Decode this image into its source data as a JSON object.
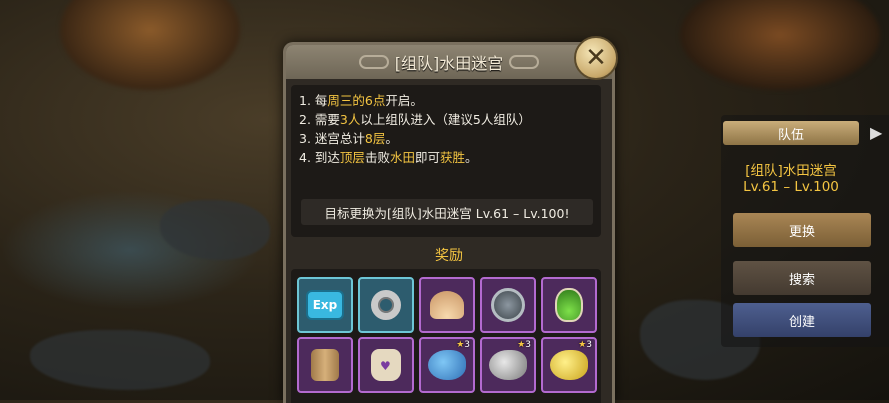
{
  "dialog": {
    "title": "[组队]水田迷宫",
    "rules": [
      {
        "num": "1.",
        "parts": [
          {
            "t": "每"
          },
          {
            "t": "周三的6点",
            "hl": true
          },
          {
            "t": "开启。"
          }
        ]
      },
      {
        "num": "2.",
        "parts": [
          {
            "t": "需要"
          },
          {
            "t": "3人",
            "hl": true
          },
          {
            "t": "以上组队进入（建议5人组队）"
          }
        ]
      },
      {
        "num": "3.",
        "parts": [
          {
            "t": "迷宫总计"
          },
          {
            "t": "8层",
            "hl": true
          },
          {
            "t": "。"
          }
        ]
      },
      {
        "num": "4.",
        "parts": [
          {
            "t": "到达"
          },
          {
            "t": "顶层",
            "hl": true
          },
          {
            "t": "击败"
          },
          {
            "t": "水田",
            "hl": true
          },
          {
            "t": "即可"
          },
          {
            "t": "获胜",
            "hl": true
          },
          {
            "t": "。"
          }
        ]
      }
    ],
    "target_text": "目标更换为[组队]水田迷宫 Lv.61 – Lv.100!",
    "reward_title": "奖励",
    "close_icon": "close-x-icon"
  },
  "rewards": [
    {
      "name": "exp-icon",
      "label": "Exp",
      "frame": "blue",
      "stars": null
    },
    {
      "name": "ring-icon",
      "label": "",
      "frame": "blue",
      "stars": null
    },
    {
      "name": "shell-icon",
      "label": "",
      "frame": "purple",
      "stars": null
    },
    {
      "name": "coin-icon",
      "label": "",
      "frame": "purple",
      "stars": null
    },
    {
      "name": "potion-icon",
      "label": "",
      "frame": "purple",
      "stars": null
    },
    {
      "name": "barrel-icon",
      "label": "",
      "frame": "purple",
      "stars": null
    },
    {
      "name": "jar-icon",
      "label": "",
      "frame": "purple",
      "stars": null
    },
    {
      "name": "blue-fish-icon",
      "label": "",
      "frame": "purple",
      "stars": "3"
    },
    {
      "name": "grey-fish-icon",
      "label": "",
      "frame": "purple",
      "stars": "3"
    },
    {
      "name": "gold-fish-icon",
      "label": "",
      "frame": "purple",
      "stars": "3"
    }
  ],
  "right_panel": {
    "header": "队伍",
    "dungeon_name": "[组队]水田迷宫",
    "level_range": "Lv.61 – Lv.100",
    "change_label": "更换",
    "search_label": "搜索",
    "create_label": "创建"
  },
  "colors": {
    "highlight": "#f4c542",
    "create_button": "#4e5f8f"
  }
}
